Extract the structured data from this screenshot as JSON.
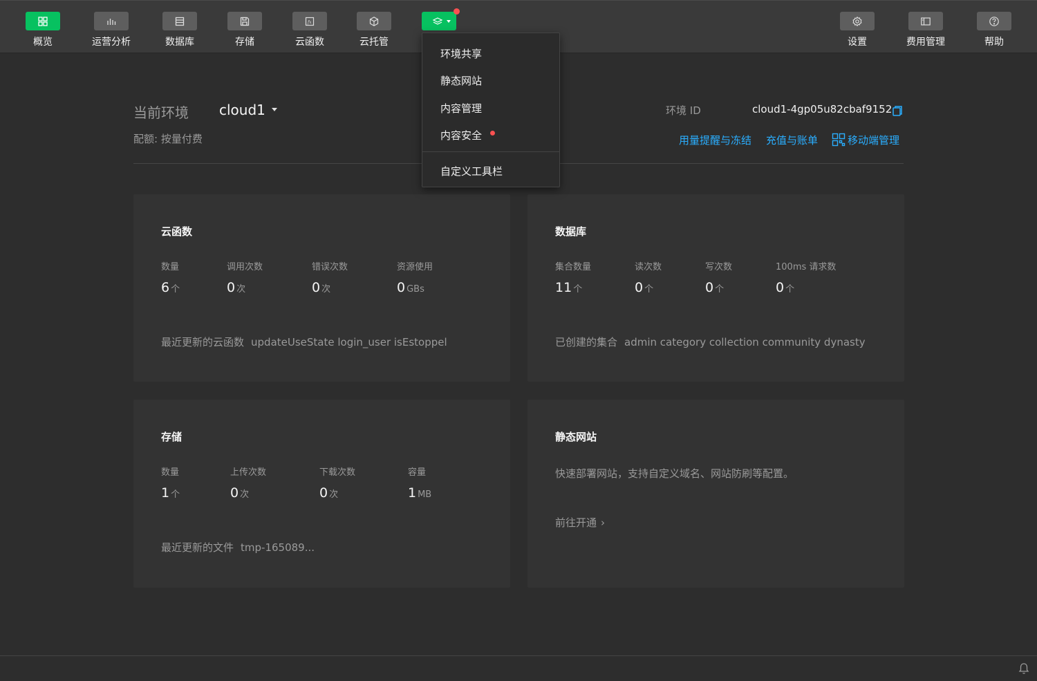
{
  "toolbar": {
    "left_items": [
      {
        "label": "概览",
        "icon": "grid-icon"
      },
      {
        "label": "运营分析",
        "icon": "bar-chart-icon"
      },
      {
        "label": "数据库",
        "icon": "database-icon"
      },
      {
        "label": "存储",
        "icon": "save-icon"
      },
      {
        "label": "云函数",
        "icon": "function-icon"
      },
      {
        "label": "云托管",
        "icon": "box-icon"
      }
    ],
    "more_icon": "layers-icon",
    "right_items": [
      {
        "label": "设置",
        "icon": "gear-icon"
      },
      {
        "label": "费用管理",
        "icon": "billing-icon"
      },
      {
        "label": "帮助",
        "icon": "help-icon"
      }
    ]
  },
  "dropdown": {
    "items": [
      "环境共享",
      "静态网站",
      "内容管理",
      "内容安全"
    ],
    "custom": "自定义工具栏"
  },
  "env": {
    "title": "当前环境",
    "name": "cloud1",
    "quota": "配额: 按量付费",
    "id_label": "环境 ID",
    "id_value": "cloud1-4gp05u82cbaf9152"
  },
  "links": {
    "usage": "用量提醒与冻结",
    "recharge": "充值与账单",
    "mobile": "移动端管理"
  },
  "cards": {
    "functions": {
      "title": "云函数",
      "stats": [
        {
          "label": "数量",
          "value": "6",
          "unit": "个"
        },
        {
          "label": "调用次数",
          "value": "0",
          "unit": "次"
        },
        {
          "label": "错误次数",
          "value": "0",
          "unit": "次"
        },
        {
          "label": "资源使用",
          "value": "0",
          "unit": "GBs"
        }
      ],
      "foot_label": "最近更新的云函数",
      "foot_items": "updateUseState  login_user  isEstoppel"
    },
    "database": {
      "title": "数据库",
      "stats": [
        {
          "label": "集合数量",
          "value": "11",
          "unit": "个"
        },
        {
          "label": "读次数",
          "value": "0",
          "unit": "个"
        },
        {
          "label": "写次数",
          "value": "0",
          "unit": "个"
        },
        {
          "label": "100ms 请求数",
          "value": "0",
          "unit": "个"
        }
      ],
      "foot_label": "已创建的集合",
      "foot_items": "admin  category  collection  community  dynasty"
    },
    "storage": {
      "title": "存储",
      "stats": [
        {
          "label": "数量",
          "value": "1",
          "unit": "个"
        },
        {
          "label": "上传次数",
          "value": "0",
          "unit": "次"
        },
        {
          "label": "下载次数",
          "value": "0",
          "unit": "次"
        },
        {
          "label": "容量",
          "value": "1",
          "unit": "MB"
        }
      ],
      "foot_label": "最近更新的文件",
      "foot_items": "tmp-165089..."
    },
    "static_site": {
      "title": "静态网站",
      "desc": "快速部署网站，支持自定义域名、网站防刷等配置。",
      "link": "前往开通"
    }
  },
  "colors": {
    "accent": "#07c160",
    "link": "#2aaeff",
    "badge": "#fa5151"
  }
}
